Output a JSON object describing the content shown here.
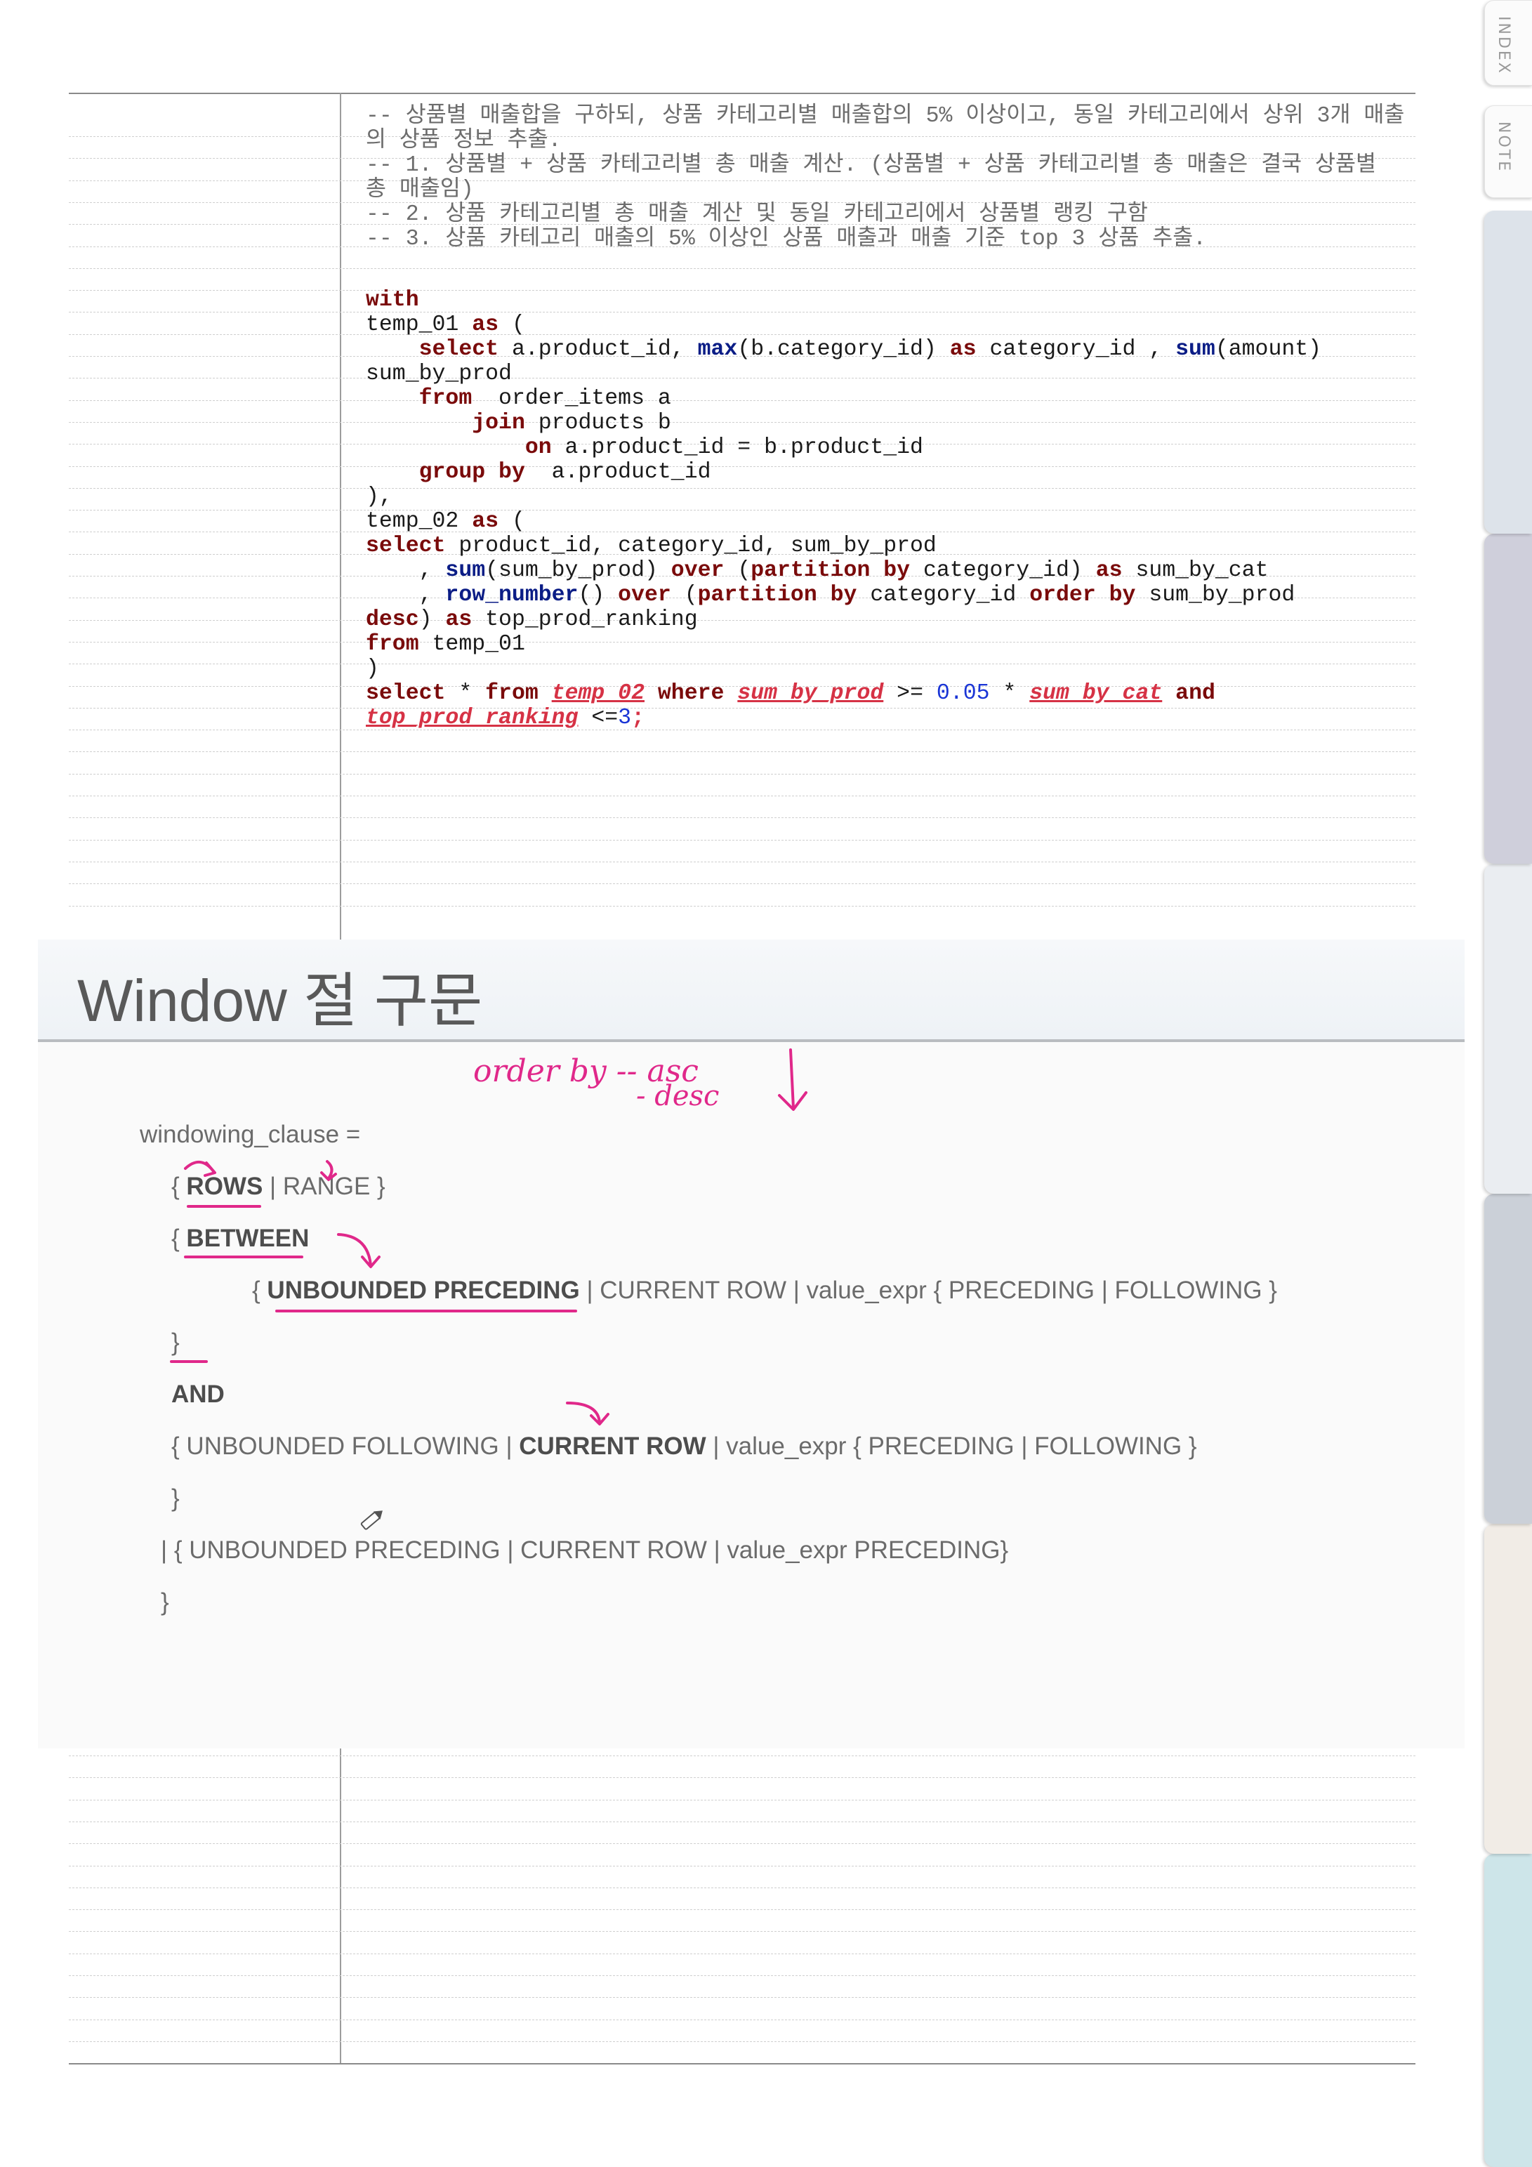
{
  "tabs": [
    {
      "label": "INDEX",
      "color": "#fbfbfb",
      "text": true
    },
    {
      "label": "NOTE",
      "color": "#fbfbfb",
      "text": true
    },
    {
      "label": "",
      "color": "#dde3ea",
      "text": false
    },
    {
      "label": "",
      "color": "#cfcfdb",
      "text": false
    },
    {
      "label": "",
      "color": "#eaedf1",
      "text": false
    },
    {
      "label": "",
      "color": "#cbd0d8",
      "text": false
    },
    {
      "label": "",
      "color": "#f1ece6",
      "text": false
    },
    {
      "label": "",
      "color": "#cde5e9",
      "text": false
    }
  ],
  "code": {
    "comments": [
      "-- 상품별 매출합을 구하되, 상품 카테고리별 매출합의 5% 이상이고, 동일 카테고리에서 상위 3개 매출",
      "의 상품 정보 추출.",
      "-- 1. 상품별 + 상품 카테고리별 총 매출 계산. (상품별 + 상품 카테고리별 총 매출은 결국 상품별",
      "총 매출임)",
      "-- 2. 상품 카테고리별 총 매출 계산 및 동일 카테고리에서 상품별 랭킹 구함",
      "-- 3. 상품 카테고리 매출의 5% 이상인 상품 매출과 매출 기준 top 3 상품 추출."
    ],
    "sql": [
      [
        {
          "t": "with",
          "c": "kw"
        }
      ],
      [
        {
          "t": "temp_01 "
        },
        {
          "t": "as",
          "c": "kw"
        },
        {
          "t": " ("
        }
      ],
      [
        {
          "t": "    "
        },
        {
          "t": "select",
          "c": "kw"
        },
        {
          "t": " a.product_id, "
        },
        {
          "t": "max",
          "c": "fn"
        },
        {
          "t": "(b.category_id) "
        },
        {
          "t": "as",
          "c": "kw"
        },
        {
          "t": " category_id , "
        },
        {
          "t": "sum",
          "c": "fn"
        },
        {
          "t": "(amount)"
        }
      ],
      [
        {
          "t": "sum_by_prod"
        }
      ],
      [
        {
          "t": "    "
        },
        {
          "t": "from",
          "c": "kw"
        },
        {
          "t": "  order_items a"
        }
      ],
      [
        {
          "t": "        "
        },
        {
          "t": "join",
          "c": "kw"
        },
        {
          "t": " products b"
        }
      ],
      [
        {
          "t": "            "
        },
        {
          "t": "on",
          "c": "kw"
        },
        {
          "t": " a.product_id = b.product_id"
        }
      ],
      [
        {
          "t": "    "
        },
        {
          "t": "group by",
          "c": "kw"
        },
        {
          "t": "  a.product_id"
        }
      ],
      [
        {
          "t": "),"
        }
      ],
      [
        {
          "t": "temp_02 "
        },
        {
          "t": "as",
          "c": "kw"
        },
        {
          "t": " ("
        }
      ],
      [
        {
          "t": "select",
          "c": "kw"
        },
        {
          "t": " product_id, category_id, sum_by_prod"
        }
      ],
      [
        {
          "t": "    , "
        },
        {
          "t": "sum",
          "c": "fn"
        },
        {
          "t": "(sum_by_prod) "
        },
        {
          "t": "over",
          "c": "kw"
        },
        {
          "t": " ("
        },
        {
          "t": "partition by",
          "c": "kw"
        },
        {
          "t": " category_id) "
        },
        {
          "t": "as",
          "c": "kw"
        },
        {
          "t": " sum_by_cat"
        }
      ],
      [
        {
          "t": "    , "
        },
        {
          "t": "row_number",
          "c": "fn"
        },
        {
          "t": "() "
        },
        {
          "t": "over",
          "c": "kw"
        },
        {
          "t": " ("
        },
        {
          "t": "partition by",
          "c": "kw"
        },
        {
          "t": " category_id "
        },
        {
          "t": "order by",
          "c": "kw"
        },
        {
          "t": " sum_by_prod"
        }
      ],
      [
        {
          "t": "desc",
          "c": "kw"
        },
        {
          "t": ") "
        },
        {
          "t": "as",
          "c": "kw"
        },
        {
          "t": " top_prod_ranking"
        }
      ],
      [
        {
          "t": "from",
          "c": "kw"
        },
        {
          "t": " temp_01"
        }
      ],
      [
        {
          "t": ")"
        }
      ],
      [
        {
          "t": "select",
          "c": "kw"
        },
        {
          "t": " * "
        },
        {
          "t": "from",
          "c": "kw"
        },
        {
          "t": " "
        },
        {
          "t": "temp_02",
          "c": "hl"
        },
        {
          "t": " "
        },
        {
          "t": "where",
          "c": "kw"
        },
        {
          "t": " "
        },
        {
          "t": "sum_by_prod",
          "c": "hl"
        },
        {
          "t": " >= "
        },
        {
          "t": "0.05",
          "c": "num"
        },
        {
          "t": " * "
        },
        {
          "t": "sum_by_cat",
          "c": "hl"
        },
        {
          "t": " "
        },
        {
          "t": "and",
          "c": "kw"
        }
      ],
      [
        {
          "t": "top_prod_ranking",
          "c": "hl"
        },
        {
          "t": " <="
        },
        {
          "t": "3",
          "c": "num"
        },
        {
          "t": ";",
          "c": "semi"
        }
      ]
    ]
  },
  "slide": {
    "title": "Window 절 구문",
    "lines": [
      {
        "segs": [
          {
            "t": "windowing_clause ="
          }
        ]
      },
      {
        "segs": [
          {
            "t": "{ "
          },
          {
            "t": "ROWS",
            "b": true
          },
          {
            "t": " | RANGE }"
          }
        ]
      },
      {
        "segs": [
          {
            "t": "{ "
          },
          {
            "t": "BETWEEN",
            "b": true
          }
        ]
      },
      {
        "segs": [
          {
            "t": "{ "
          },
          {
            "t": "UNBOUNDED PRECEDING",
            "b": true
          },
          {
            "t": " | CURRENT ROW | value_expr { PRECEDING | FOLLOWING }"
          }
        ]
      },
      {
        "segs": [
          {
            "t": "}"
          }
        ]
      },
      {
        "segs": [
          {
            "t": "AND",
            "b": true
          }
        ]
      },
      {
        "segs": [
          {
            "t": "{ UNBOUNDED FOLLOWING | "
          },
          {
            "t": "CURRENT ROW",
            "b": true
          },
          {
            "t": " | value_expr { PRECEDING | FOLLOWING }"
          }
        ]
      },
      {
        "segs": [
          {
            "t": "}"
          }
        ]
      },
      {
        "segs": [
          {
            "t": "| { UNBOUNDED PRECEDING | CURRENT ROW | value_expr PRECEDING}"
          }
        ]
      },
      {
        "segs": [
          {
            "t": "}"
          }
        ]
      }
    ],
    "handwriting": {
      "line1": "order by -- asc",
      "line2": "- desc",
      "ink_color": "#e0288a"
    }
  }
}
